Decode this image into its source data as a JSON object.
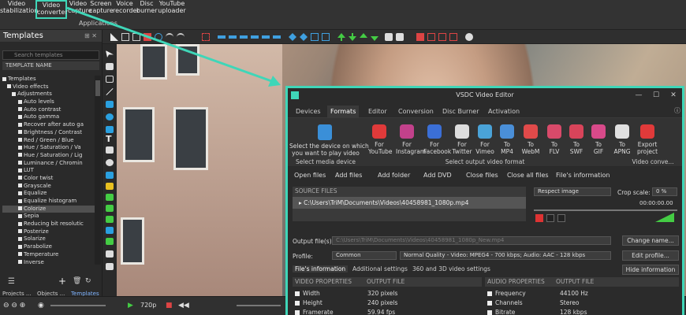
{
  "topbar": {
    "buttons": [
      {
        "label": "Video\nstabilization"
      },
      {
        "label": "Video\nconverter"
      },
      {
        "label": "Video\ncapture"
      },
      {
        "label": "Screen\ncapture"
      },
      {
        "label": "Voice\nrecorder"
      },
      {
        "label": "Disc\nburner"
      },
      {
        "label": "YouTube\nuploader"
      }
    ],
    "group_label": "Applications"
  },
  "left_panel": {
    "title": "Templates",
    "search_placeholder": "Search templates",
    "column_header": "TEMPLATE NAME",
    "tree": [
      "Templates",
      "Video effects",
      "Adjustments",
      "Auto levels",
      "Auto contrast",
      "Auto gamma",
      "Recover after auto ga",
      "Brightness / Contrast",
      "Red / Green / Blue",
      "Hue / Saturation / Va",
      "Hue / Saturation / Lig",
      "Luminance / Chromin",
      "LUT",
      "Color twist",
      "Grayscale",
      "Equalize",
      "Equalize histogram",
      "Colorize",
      "Sepia",
      "Reducing bit resolutic",
      "Posterize",
      "Solarize",
      "Parabolize",
      "Temperature",
      "Inverse"
    ],
    "selected_index": 17,
    "bottom_tabs": [
      "Projects ...",
      "Objects ...",
      "Templates"
    ]
  },
  "bottombar": {
    "resolution": "720p"
  },
  "dialog": {
    "title": "VSDC Video Editor",
    "tabs": [
      "Devices",
      "Formats",
      "Editor",
      "Conversion",
      "Disc Burner",
      "Activation"
    ],
    "active_tab": "Formats",
    "device_desc": "Select the device on which\nyou want to play video",
    "device_section": "Select media device",
    "formats": [
      {
        "label": "For\nYouTube",
        "color": "#e03a3a"
      },
      {
        "label": "For\nInstagram",
        "color": "#c2418b"
      },
      {
        "label": "For\nFacebook",
        "color": "#3b6fd6"
      },
      {
        "label": "For\nTwitter",
        "color": "#dddddd"
      },
      {
        "label": "For\nVimeo",
        "color": "#4aa3d8"
      },
      {
        "label": "To\nMP4",
        "color": "#4a8fd8"
      },
      {
        "label": "To\nWebM",
        "color": "#e04a4a"
      },
      {
        "label": "To\nFLV",
        "color": "#d84a6a"
      },
      {
        "label": "To\nSWF",
        "color": "#d8445a"
      },
      {
        "label": "To\nGIF",
        "color": "#d84a8a"
      },
      {
        "label": "To\nAPNG",
        "color": "#e0e0e0"
      },
      {
        "label": "Export\nproject",
        "color": "#e03a3a"
      }
    ],
    "formats_section": "Select output video format",
    "export_section": "Video conve...",
    "actions": [
      "Open files",
      "Add files",
      "Add folder",
      "Add DVD",
      "Close files",
      "Close all files",
      "File's information"
    ],
    "source_header": "SOURCE FILES",
    "source_file": "C:\\Users\\TriM\\Documents\\Videos\\40458981_1080p.mp4",
    "aspect": "Respect image",
    "crop_label": "Crop scale:",
    "crop_value": "0 %",
    "time": "00:00:00.00",
    "output_label": "Output file(s):",
    "output_value": "C:\\Users\\TriM\\Documents\\Videos\\40458981_1080p_New.mp4",
    "change_name": "Change name...",
    "profile_label": "Profile:",
    "profile_value": "Common",
    "quality_value": "Normal Quality - Video: MPEG4 - 700 kbps; Audio: AAC - 128 kbps",
    "edit_profile": "Edit profile...",
    "hide_info": "Hide information",
    "info_tabs": [
      "File's information",
      "Additional settings",
      "360 and 3D video settings"
    ],
    "table_headers": [
      "VIDEO PROPERTIES",
      "OUTPUT FILE",
      "AUDIO PROPERTIES",
      "OUTPUT FILE"
    ],
    "video_rows": [
      {
        "name": "Width",
        "value": "320 pixels"
      },
      {
        "name": "Height",
        "value": "240 pixels"
      },
      {
        "name": "Framerate",
        "value": "59.94 fps"
      }
    ],
    "audio_rows": [
      {
        "name": "Frequency",
        "value": "44100 Hz"
      },
      {
        "name": "Channels",
        "value": "Stereo"
      },
      {
        "name": "Bitrate",
        "value": "128 kbps"
      }
    ]
  }
}
